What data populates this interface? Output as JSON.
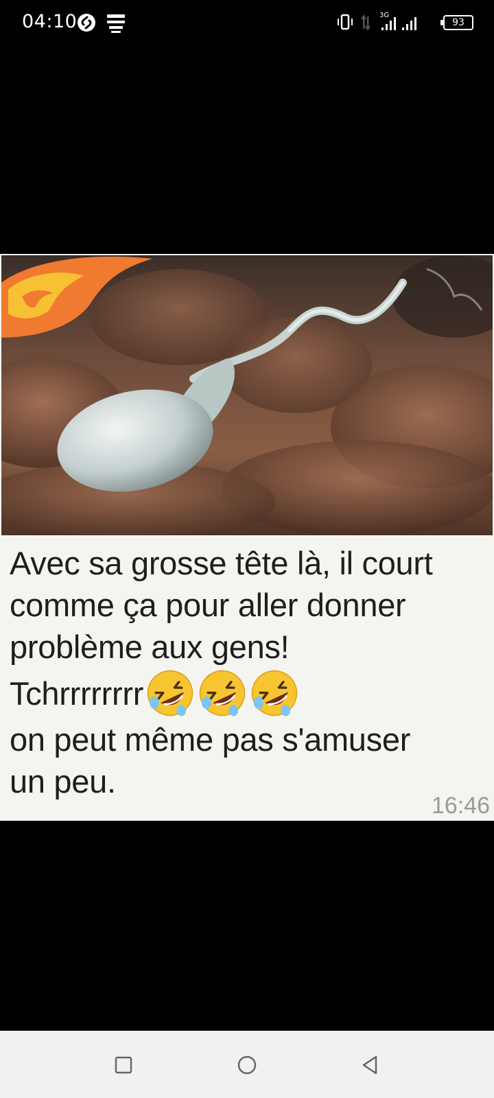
{
  "status_bar": {
    "time": "04:10",
    "battery": "93",
    "network": "3G",
    "icons": [
      "shazam-icon",
      "notification-stack-icon",
      "vibrate-icon",
      "data-transfer-icon",
      "signal-icon",
      "signal-icon",
      "battery-icon"
    ]
  },
  "message": {
    "lines": [
      "Avec sa grosse tête là, il court",
      "comme ça pour aller donner",
      "problème aux gens!",
      "Tchrrrrrrrr",
      "on peut même pas s'amuser",
      "un peu."
    ],
    "emoji_count": 3,
    "emoji_name": "rolling-on-floor-laughing",
    "time": "16:46"
  },
  "nav_bar": {
    "buttons": [
      "recents",
      "home",
      "back"
    ]
  },
  "colors": {
    "background": "#000000",
    "card": "#f4f5f0",
    "text": "#1e1e1e",
    "timestamp": "#9a9a9a",
    "nav": "#f1f1f1"
  }
}
